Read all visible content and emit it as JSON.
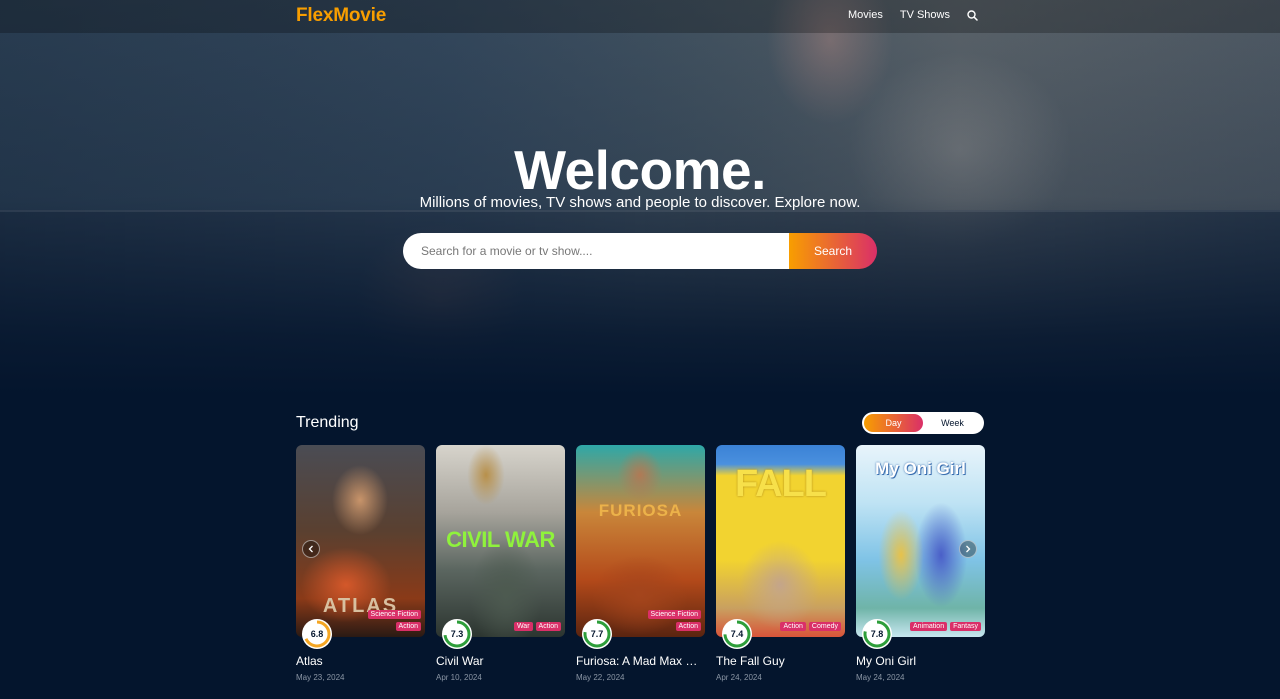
{
  "header": {
    "logo": "FlexMovie",
    "nav": [
      "Movies",
      "TV Shows"
    ]
  },
  "hero": {
    "title": "Welcome.",
    "subtitle": "Millions of movies, TV shows and people to discover. Explore now.",
    "search": {
      "placeholder": "Search for a movie or tv show....",
      "button_label": "Search"
    }
  },
  "trending": {
    "title": "Trending",
    "tabs": [
      "Day",
      "Week"
    ],
    "active_tab": "Day",
    "items": [
      {
        "title": "Atlas",
        "date": "May 23, 2024",
        "rating": "6.8",
        "rating_value": 6.8,
        "genres": [
          "Science Fiction",
          "Action"
        ],
        "ring_color": "#f5a623"
      },
      {
        "title": "Civil War",
        "date": "Apr 10, 2024",
        "rating": "7.3",
        "rating_value": 7.3,
        "genres": [
          "War",
          "Action"
        ],
        "ring_color": "#2e9e3a"
      },
      {
        "title": "Furiosa: A Mad Max Saga",
        "date": "May 22, 2024",
        "rating": "7.7",
        "rating_value": 7.7,
        "genres": [
          "Science Fiction",
          "Action"
        ],
        "ring_color": "#2e9e3a"
      },
      {
        "title": "The Fall Guy",
        "date": "Apr 24, 2024",
        "rating": "7.4",
        "rating_value": 7.4,
        "genres": [
          "Action",
          "Comedy"
        ],
        "ring_color": "#2e9e3a"
      },
      {
        "title": "My Oni Girl",
        "date": "May 24, 2024",
        "rating": "7.8",
        "rating_value": 7.8,
        "genres": [
          "Animation",
          "Fantasy"
        ],
        "ring_color": "#2e9e3a"
      }
    ],
    "poster_texts": [
      "ATLAS",
      "CIVIL WAR",
      "FURIOSA",
      "FALL",
      "My Oni Girl"
    ]
  },
  "colors": {
    "accent_orange": "#f89e00",
    "accent_pink": "#da2f68",
    "background": "#04152d"
  },
  "icons": {
    "search": "search-icon",
    "prev": "chevron-left-icon",
    "next": "chevron-right-icon"
  }
}
